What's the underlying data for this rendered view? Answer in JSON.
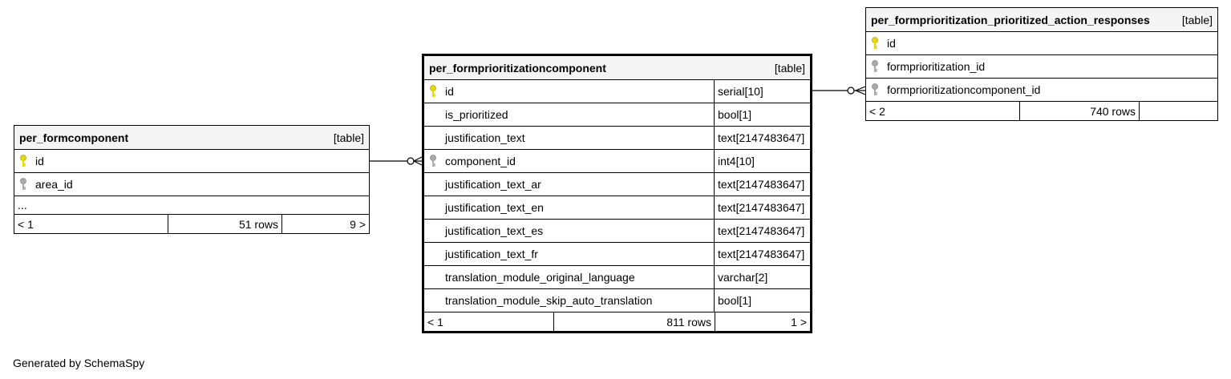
{
  "caption": "Generated by SchemaSpy",
  "colors": {
    "primary_key": "#e8d800",
    "foreign_key": "#aaaaaa",
    "header_bg": "#f4f4f4",
    "line": "#000000"
  },
  "tables": {
    "formcomponent": {
      "name": "per_formcomponent",
      "kind": "[table]",
      "columns": [
        {
          "name": "id",
          "key": "primary"
        },
        {
          "name": "area_id",
          "key": "foreign"
        }
      ],
      "more": "...",
      "footer": {
        "parents": "< 1",
        "rows": "51 rows",
        "children": "9 >"
      }
    },
    "prioritizationcomponent": {
      "name": "per_formprioritizationcomponent",
      "kind": "[table]",
      "columns": [
        {
          "name": "id",
          "type": "serial[10]",
          "key": "primary"
        },
        {
          "name": "is_prioritized",
          "type": "bool[1]",
          "key": "none"
        },
        {
          "name": "justification_text",
          "type": "text[2147483647]",
          "key": "none"
        },
        {
          "name": "component_id",
          "type": "int4[10]",
          "key": "foreign"
        },
        {
          "name": "justification_text_ar",
          "type": "text[2147483647]",
          "key": "none"
        },
        {
          "name": "justification_text_en",
          "type": "text[2147483647]",
          "key": "none"
        },
        {
          "name": "justification_text_es",
          "type": "text[2147483647]",
          "key": "none"
        },
        {
          "name": "justification_text_fr",
          "type": "text[2147483647]",
          "key": "none"
        },
        {
          "name": "translation_module_original_language",
          "type": "varchar[2]",
          "key": "none"
        },
        {
          "name": "translation_module_skip_auto_translation",
          "type": "bool[1]",
          "key": "none"
        }
      ],
      "footer": {
        "parents": "< 1",
        "rows": "811 rows",
        "children": "1 >"
      }
    },
    "action_responses": {
      "name": "per_formprioritization_prioritized_action_responses",
      "kind": "[table]",
      "columns": [
        {
          "name": "id",
          "key": "primary"
        },
        {
          "name": "formprioritization_id",
          "key": "foreign"
        },
        {
          "name": "formprioritizationcomponent_id",
          "key": "foreign"
        }
      ],
      "footer": {
        "parents": "< 2",
        "rows": "740 rows",
        "children": ""
      }
    }
  }
}
